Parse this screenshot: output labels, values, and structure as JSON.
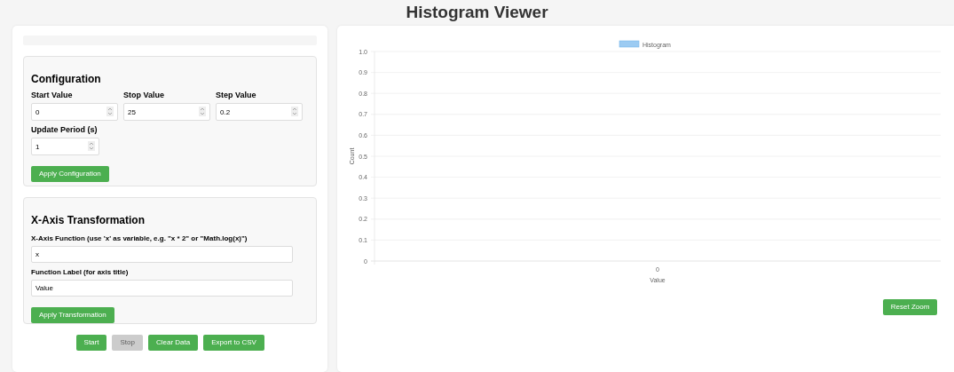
{
  "title": "Histogram Viewer",
  "configuration": {
    "heading": "Configuration",
    "fields": [
      {
        "label": "Start Value",
        "value": "0"
      },
      {
        "label": "Stop Value",
        "value": "25"
      },
      {
        "label": "Step Value",
        "value": "0.2"
      },
      {
        "label": "Update Period (s)",
        "value": "1"
      }
    ],
    "apply_button": "Apply Configuration"
  },
  "transformation": {
    "heading": "X-Axis Transformation",
    "fields": [
      {
        "label": "X-Axis Function (use 'x' as variable, e.g. \"x * 2\" or \"Math.log(x)\")",
        "value": "x"
      },
      {
        "label": "Function Label (for axis title)",
        "value": "Value"
      }
    ],
    "apply_button": "Apply Transformation"
  },
  "controls": [
    {
      "label": "Start",
      "disabled": false
    },
    {
      "label": "Stop",
      "disabled": true
    },
    {
      "label": "Clear Data",
      "disabled": false
    },
    {
      "label": "Export to CSV",
      "disabled": false
    }
  ],
  "chart": {
    "chart_data": {
      "type": "bar",
      "xlabel": "Value",
      "ylabel": "Count",
      "categories": [
        "0"
      ],
      "series": [
        {
          "name": "Histogram",
          "color": "#9ccbf2",
          "values": [
            null
          ]
        }
      ],
      "grid": true,
      "ylim": [
        0,
        1
      ],
      "yticks": [
        0,
        0.1,
        0.2,
        0.3,
        0.4,
        0.5,
        0.6,
        0.7,
        0.8,
        0.9,
        {
          "value": 1,
          "label": "1.0"
        }
      ]
    },
    "reset_button": "Reset Zoom"
  }
}
